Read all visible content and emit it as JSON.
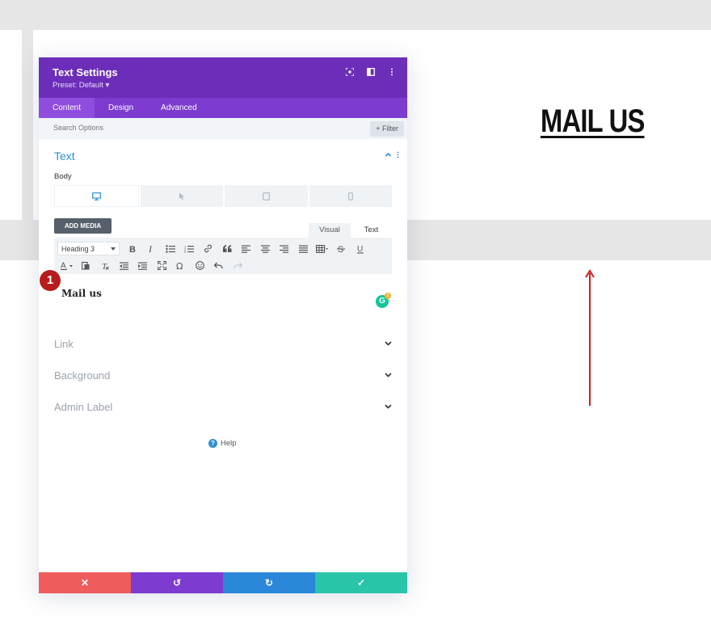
{
  "page": {
    "heading": "MAIL US",
    "accent_arrow_color": "#cc1f1f"
  },
  "modal": {
    "title": "Text Settings",
    "preset": "Preset: Default ▾",
    "header_icons": [
      "focus-icon",
      "split-view-icon",
      "more-vertical-icon"
    ],
    "tabs": [
      {
        "label": "Content",
        "active": true
      },
      {
        "label": "Design",
        "active": false
      },
      {
        "label": "Advanced",
        "active": false
      }
    ],
    "search": {
      "placeholder": "Search Options"
    },
    "filter_label": "+ Filter",
    "section": {
      "title": "Text",
      "body_label": "Body",
      "devices": [
        "desktop-icon",
        "hover-icon",
        "tablet-icon",
        "phone-icon"
      ]
    },
    "editor": {
      "add_media": "ADD MEDIA",
      "tab_visual": "Visual",
      "tab_text": "Text",
      "format_select": "Heading 3",
      "content": "Mail us",
      "grammarly_letter": "G",
      "grammarly_count": "1"
    },
    "collapsed_sections": [
      "Link",
      "Background",
      "Admin Label"
    ],
    "help": {
      "icon": "?",
      "label": "Help"
    },
    "footer": {
      "cancel": "✕",
      "undo": "↺",
      "redo": "↻",
      "save": "✓"
    }
  },
  "annotation": {
    "step_number": "1"
  },
  "colors": {
    "header_purple": "#6c2eb9",
    "tabs_purple": "#7d3bd0",
    "accent_blue": "#2e8fd1",
    "cancel_red": "#ef5c5c",
    "redo_blue": "#2b87da",
    "save_green": "#29c4a9"
  }
}
